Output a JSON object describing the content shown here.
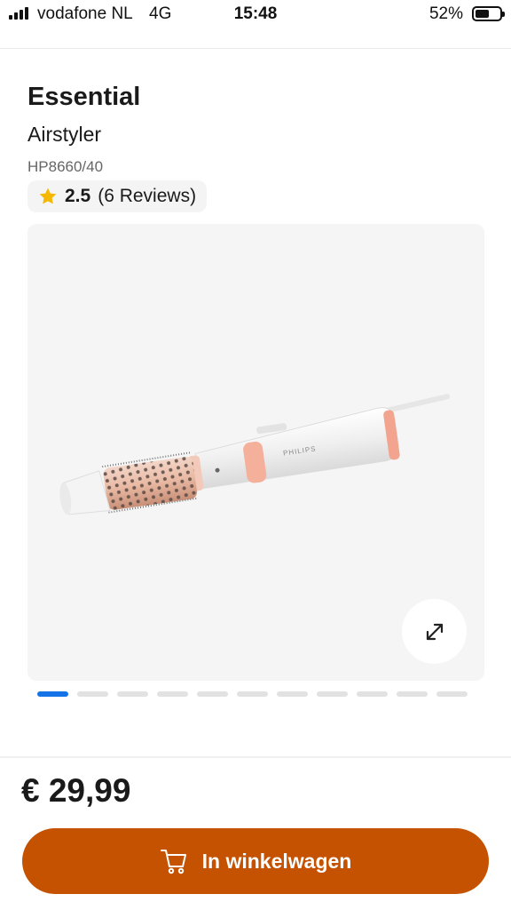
{
  "status_bar": {
    "carrier": "vodafone NL",
    "network": "4G",
    "time": "15:48",
    "battery": "52%",
    "battery_level": 0.52
  },
  "product": {
    "brand": "Essential",
    "name": "Airstyler",
    "model": "HP8660/40",
    "image_logo_text": "PHILIPS"
  },
  "rating": {
    "icon": "star-icon",
    "value": "2.5",
    "count": "(6 Reviews)"
  },
  "gallery": {
    "expand_icon": "expand-icon",
    "total_images": 11,
    "active_index": 0
  },
  "purchase": {
    "price": "€ 29,99",
    "cart_icon": "cart-icon",
    "cart_label": "In winkelwagen"
  },
  "colors": {
    "accent": "#c45200",
    "active_dot": "#1473e6",
    "star": "#f5b800"
  }
}
